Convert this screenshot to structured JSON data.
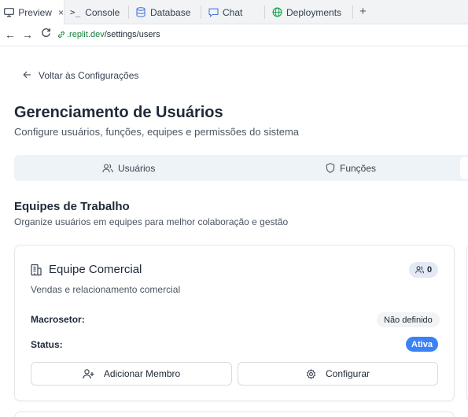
{
  "browser": {
    "tabs": [
      {
        "label": "Preview",
        "icon": "monitor-icon",
        "active": true,
        "close": "×"
      },
      {
        "label": "Console",
        "icon": "terminal-icon",
        "prefix": ">_"
      },
      {
        "label": "Database",
        "icon": "database-icon"
      },
      {
        "label": "Chat",
        "icon": "chat-icon"
      },
      {
        "label": "Deployments",
        "icon": "globe-icon"
      }
    ],
    "new_tab": "+",
    "nav": {
      "back": "←",
      "forward": "→",
      "reload": "C"
    },
    "url_host": ".replit.dev",
    "url_path": "/settings/users"
  },
  "page": {
    "back_label": "Voltar às Configurações",
    "title": "Gerenciamento de Usuários",
    "subtitle": "Configure usuários, funções, equipes e permissões do sistema",
    "tabs": [
      {
        "label": "Usuários",
        "icon": "users-icon"
      },
      {
        "label": "Funções",
        "icon": "shield-icon"
      }
    ]
  },
  "teams": {
    "title": "Equipes de Trabalho",
    "subtitle": "Organize usuários em equipes para melhor colaboração e gestão",
    "cards": [
      {
        "name": "Equipe Comercial",
        "member_count": "0",
        "description": "Vendas e relacionamento comercial",
        "macrosetor_label": "Macrosetor:",
        "macrosetor_value": "Não definido",
        "status_label": "Status:",
        "status_value": "Ativa",
        "add_member_label": "Adicionar Membro",
        "configure_label": "Configurar"
      }
    ]
  },
  "colors": {
    "accent": "#3b82f6",
    "url_host": "#15803d",
    "tab_bg": "#eef3f7"
  }
}
